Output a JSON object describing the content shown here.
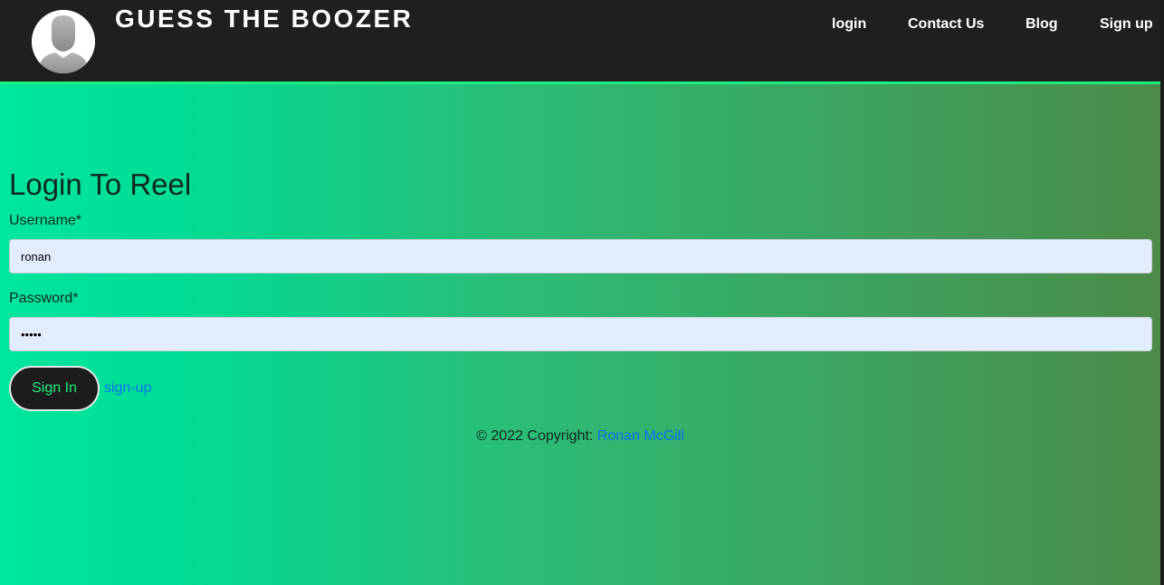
{
  "header": {
    "brand": "GUESS THE BOOZER",
    "avatar_icon": "user-avatar-icon",
    "accent_color": "#1cf07f",
    "nav": {
      "login": "login",
      "contact": "Contact Us",
      "blog": "Blog",
      "signup": "Sign up"
    }
  },
  "form": {
    "title": "Login To Reel",
    "username_label": "Username*",
    "username_value": "ronan",
    "password_label": "Password*",
    "password_value": "•••••",
    "submit_label": "Sign In",
    "signup_link": "sign-up"
  },
  "footer": {
    "copyright": "© 2022 Copyright: ",
    "author": "Ronan McGill"
  }
}
